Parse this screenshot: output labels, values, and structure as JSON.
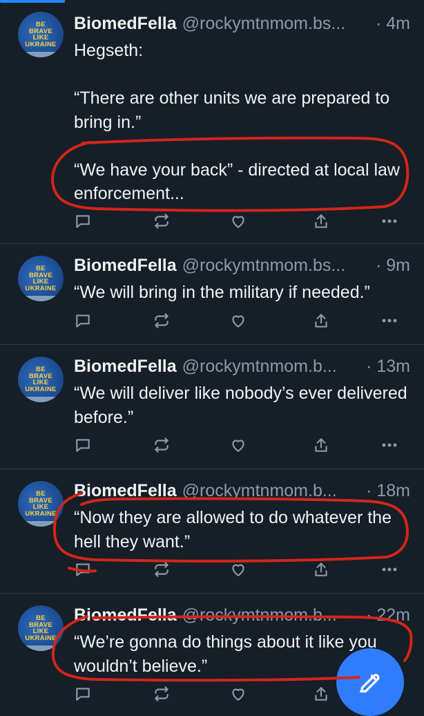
{
  "posts": [
    {
      "name": "BiomedFella",
      "handle": "@rockymtnmom.bs...",
      "time": "· 4m",
      "text": "Hegseth:\n\n“There are other units we are prepared to bring in.”\n\n“We have your back” - directed at local law enforcement..."
    },
    {
      "name": "BiomedFella",
      "handle": "@rockymtnmom.bs...",
      "time": "· 9m",
      "text": "“We will bring in the military if needed.”"
    },
    {
      "name": "BiomedFella",
      "handle": "@rockymtnmom.b...",
      "time": "· 13m",
      "text": "“We will deliver like nobody’s ever delivered before.”"
    },
    {
      "name": "BiomedFella",
      "handle": "@rockymtnmom.b...",
      "time": "· 18m",
      "text": "“Now they are allowed to do whatever the hell they want.”"
    },
    {
      "name": "BiomedFella",
      "handle": "@rockymtnmom.b...",
      "time": "· 22m",
      "text": "“We’re gonna do things about it like you wouldn’t believe.”"
    }
  ],
  "avatar_text": [
    "BE",
    "BRAVE",
    "LIKE",
    "UKRAINE"
  ],
  "icons": [
    "reply-icon",
    "repost-icon",
    "like-icon",
    "share-icon",
    "more-icon",
    "compose-icon"
  ],
  "colors": {
    "background": "#161e27",
    "text": "#f1f3f5",
    "muted": "#8c9aa8",
    "accent": "#2f7dfb",
    "annotation": "#d3261a"
  }
}
